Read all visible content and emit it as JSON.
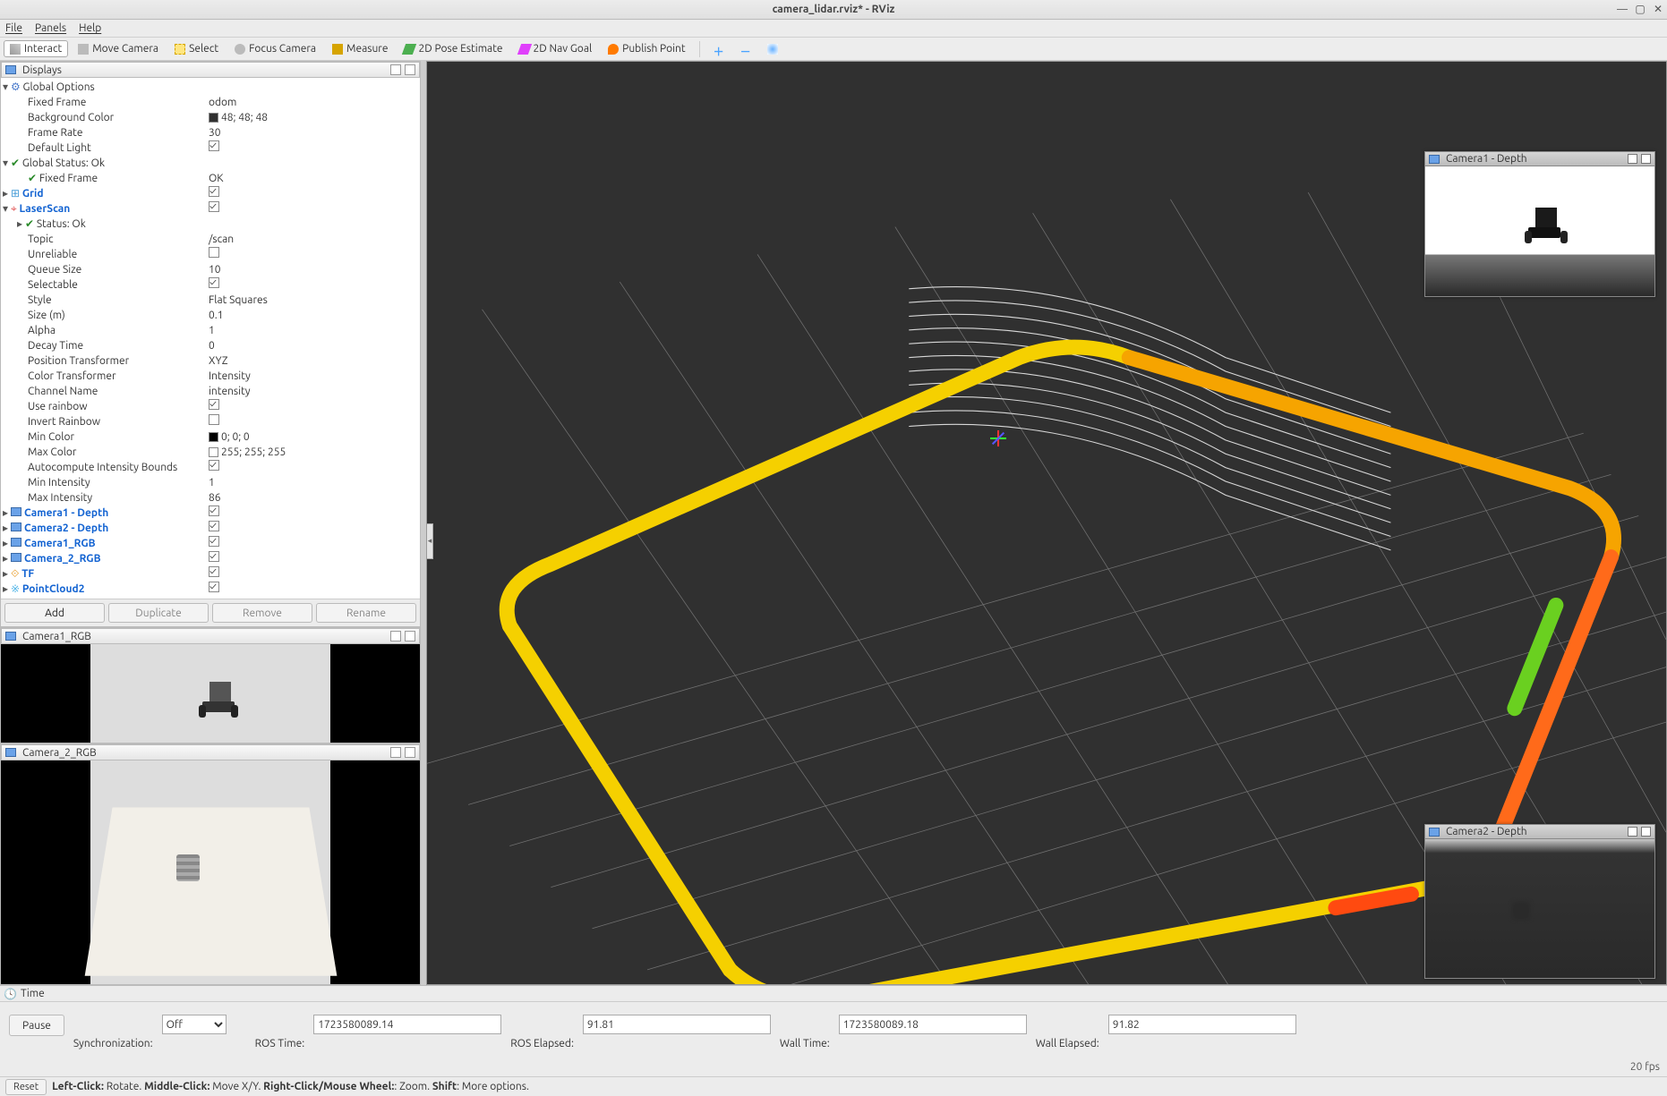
{
  "window": {
    "title": "camera_lidar.rviz* - RViz"
  },
  "menubar": {
    "file": "File",
    "panels": "Panels",
    "help": "Help"
  },
  "toolbar": {
    "interact": "Interact",
    "move": "Move Camera",
    "select": "Select",
    "focus": "Focus Camera",
    "measure": "Measure",
    "pose": "2D Pose Estimate",
    "nav": "2D Nav Goal",
    "publish": "Publish Point"
  },
  "panels": {
    "displays": "Displays",
    "camera1_rgb": "Camera1_RGB",
    "camera2_rgb": "Camera_2_RGB",
    "camera1_depth": "Camera1 - Depth",
    "camera2_depth": "Camera2 - Depth",
    "time": "Time"
  },
  "tree": {
    "global_options": "Global Options",
    "fixed_frame_k": "Fixed Frame",
    "fixed_frame_v": "odom",
    "bgcolor_k": "Background Color",
    "bgcolor_v": "48; 48; 48",
    "framerate_k": "Frame Rate",
    "framerate_v": "30",
    "default_light_k": "Default Light",
    "global_status": "Global Status: Ok",
    "fixed_frame_status_k": "Fixed Frame",
    "fixed_frame_status_v": "OK",
    "grid": "Grid",
    "laserscan": "LaserScan",
    "status_ok": "Status: Ok",
    "topic_k": "Topic",
    "topic_v": "/scan",
    "unreliable_k": "Unreliable",
    "queue_k": "Queue Size",
    "queue_v": "10",
    "selectable_k": "Selectable",
    "style_k": "Style",
    "style_v": "Flat Squares",
    "size_k": "Size (m)",
    "size_v": "0.1",
    "alpha_k": "Alpha",
    "alpha_v": "1",
    "decay_k": "Decay Time",
    "decay_v": "0",
    "postr_k": "Position Transformer",
    "postr_v": "XYZ",
    "coltr_k": "Color Transformer",
    "coltr_v": "Intensity",
    "chan_k": "Channel Name",
    "chan_v": "intensity",
    "rainbow_k": "Use rainbow",
    "invrain_k": "Invert Rainbow",
    "mincol_k": "Min Color",
    "mincol_v": "0; 0; 0",
    "maxcol_k": "Max Color",
    "maxcol_v": "255; 255; 255",
    "autoint_k": "Autocompute Intensity Bounds",
    "minint_k": "Min Intensity",
    "minint_v": "1",
    "maxint_k": "Max Intensity",
    "maxint_v": "86",
    "cam1d": "Camera1 - Depth",
    "cam2d": "Camera2 - Depth",
    "cam1r": "Camera1_RGB",
    "cam2r": "Camera_2_RGB",
    "tf": "TF",
    "pc2": "PointCloud2"
  },
  "buttons": {
    "add": "Add",
    "duplicate": "Duplicate",
    "remove": "Remove",
    "rename": "Rename"
  },
  "time": {
    "pause": "Pause",
    "sync_label": "Synchronization:",
    "sync_val": "Off",
    "ros_time_l": "ROS Time:",
    "ros_time_v": "1723580089.14",
    "ros_el_l": "ROS Elapsed:",
    "ros_el_v": "91.81",
    "wall_time_l": "Wall Time:",
    "wall_time_v": "1723580089.18",
    "wall_el_l": "Wall Elapsed:",
    "wall_el_v": "91.82",
    "fps": "20 fps"
  },
  "status": {
    "reset": "Reset",
    "hint_b1": "Left-Click:",
    "hint_t1": " Rotate. ",
    "hint_b2": "Middle-Click:",
    "hint_t2": " Move X/Y. ",
    "hint_b3": "Right-Click/Mouse Wheel:",
    "hint_t3": ": Zoom. ",
    "hint_b4": "Shift",
    "hint_t4": ": More options."
  }
}
